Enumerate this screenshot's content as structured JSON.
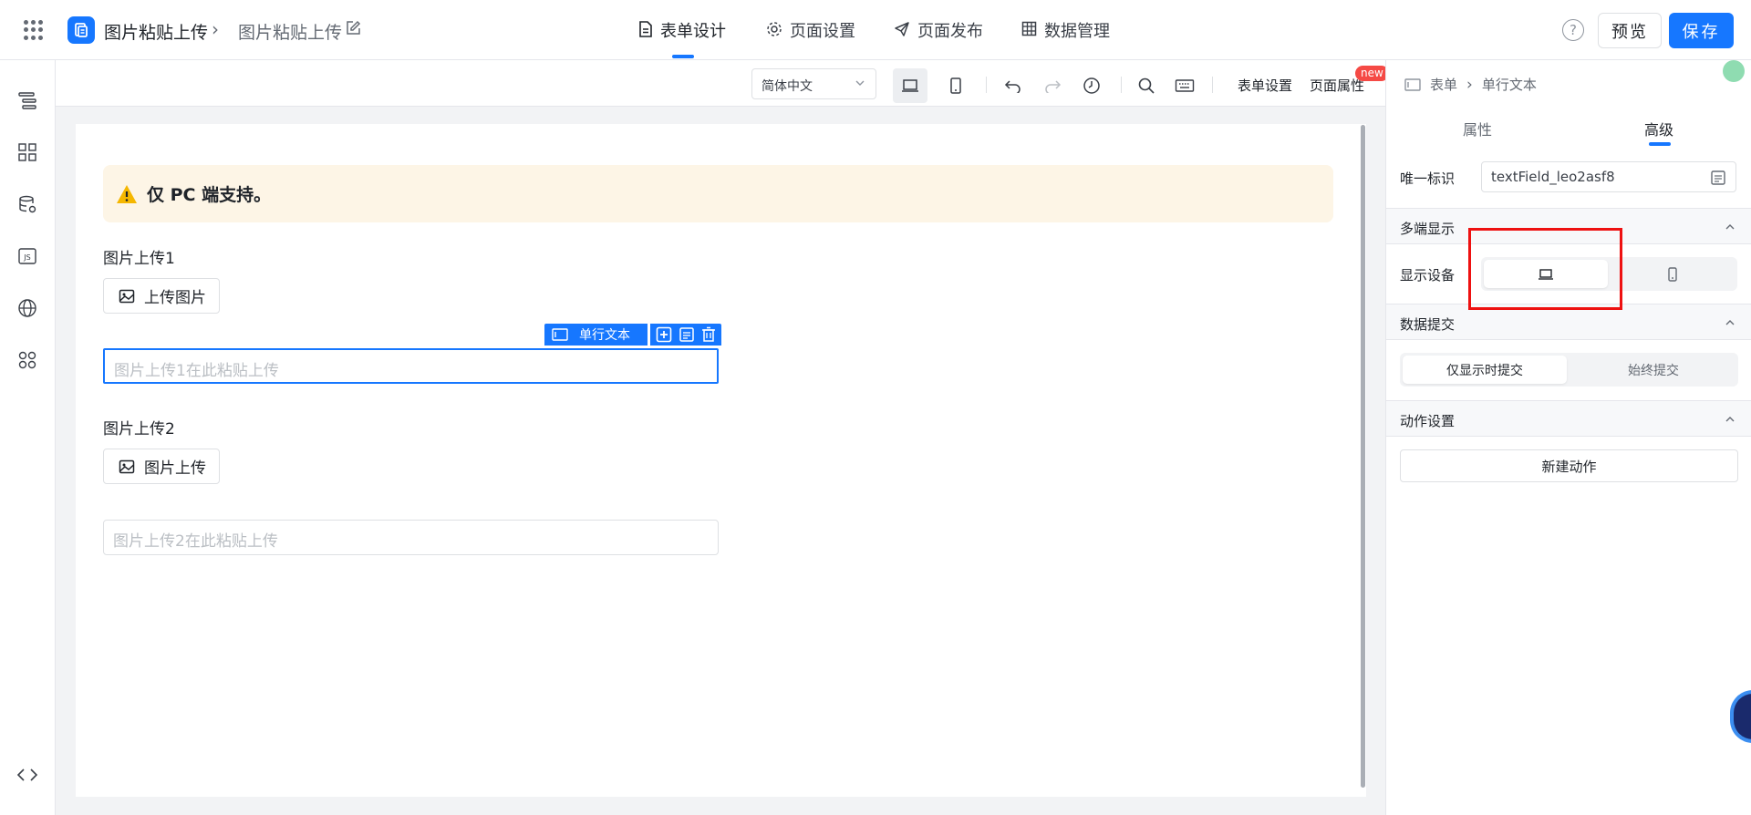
{
  "header": {
    "app_title": "图片粘贴上传",
    "page_title": "图片粘贴上传",
    "tabs": [
      {
        "label": "表单设计",
        "icon": "document-icon",
        "active": true
      },
      {
        "label": "页面设置",
        "icon": "gear-icon",
        "active": false
      },
      {
        "label": "页面发布",
        "icon": "send-icon",
        "active": false
      },
      {
        "label": "数据管理",
        "icon": "table-icon",
        "active": false
      }
    ],
    "help_label": "?",
    "preview_label": "预览",
    "save_label": "保存",
    "accent_color": "#1677ff"
  },
  "left_rail": {
    "icons": [
      "outline-icon",
      "components-icon",
      "datasource-icon",
      "js-icon",
      "globe-icon",
      "apps-icon",
      "code-icon"
    ],
    "js_label": "JS"
  },
  "toolbar": {
    "language": "简体中文",
    "form_settings": "表单设置",
    "page_properties": "页面属性",
    "new_badge": "new"
  },
  "canvas": {
    "notice": "仅 PC 端支持。",
    "fields": [
      {
        "label": "图片上传1",
        "upload_button": "上传图片",
        "paste_placeholder": "图片上传1在此粘贴上传"
      },
      {
        "label": "图片上传2",
        "upload_button": "图片上传",
        "paste_placeholder": "图片上传2在此粘贴上传"
      }
    ],
    "selected_tag": "单行文本"
  },
  "right_panel": {
    "breadcrumb": [
      "表单",
      "单行文本"
    ],
    "tabs": [
      {
        "label": "属性",
        "active": false
      },
      {
        "label": "高级",
        "active": true
      }
    ],
    "unique_id_label": "唯一标识",
    "unique_id_value": "textField_leo2asf8",
    "section_multi": "多端显示",
    "display_device_label": "显示设备",
    "section_submit": "数据提交",
    "submit_options": [
      "仅显示时提交",
      "始终提交"
    ],
    "submit_selected": "仅显示时提交",
    "section_action": "动作设置",
    "new_action": "新建动作"
  }
}
